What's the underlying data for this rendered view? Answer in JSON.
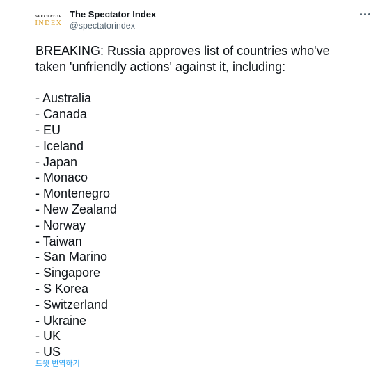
{
  "header": {
    "avatar_top": "SPECTATOR",
    "avatar_bottom": "INDEX",
    "display_name": "The Spectator Index",
    "handle": "@spectatorindex",
    "more_icon": "more-horizontal-icon"
  },
  "tweet": {
    "intro_line1": "BREAKING: Russia approves list of countries who've",
    "intro_line2": "taken 'unfriendly actions' against it, including:",
    "countries": [
      "- Australia",
      "- Canada",
      "- EU",
      "- Iceland",
      "- Japan",
      "- Monaco",
      "- Montenegro",
      "- New Zealand",
      "- Norway",
      "- Taiwan",
      "- San Marino",
      "- Singapore",
      "- S Korea",
      "- Switzerland",
      "- Ukraine",
      "- UK",
      "- US"
    ],
    "translate_label": "트윗 번역하기"
  },
  "colors": {
    "text": "#0f1419",
    "secondary": "#536471",
    "link": "#1d9bf0",
    "brand_gold": "#d89a1e"
  }
}
